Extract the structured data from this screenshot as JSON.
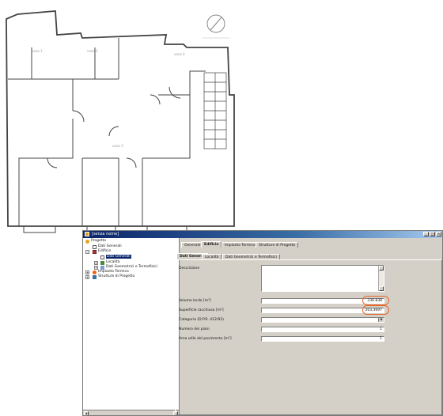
{
  "floor_plan": {
    "room_labels": [
      "vano 1",
      "vano 2",
      "vano 3",
      "vano 4"
    ],
    "north_symbol": "north-arrow-icon",
    "line_color": "#444444"
  },
  "window": {
    "title": "[senza nome]",
    "title_icon": "project-icon",
    "controls": [
      "_",
      "□",
      "×"
    ]
  },
  "tree": {
    "items": [
      {
        "label": "Progetto",
        "icon": "project-icon"
      },
      {
        "label": "Dati Generali",
        "icon": "document-icon"
      },
      {
        "label": "Edificio",
        "icon": "building-icon"
      },
      {
        "label": "Dati Generali",
        "icon": "document-icon",
        "selected": true
      },
      {
        "label": "Località",
        "icon": "location-icon"
      },
      {
        "label": "Dati Geometrici e Termofisici",
        "icon": "geometry-icon"
      },
      {
        "label": "Impianto Termico",
        "icon": "heating-icon"
      },
      {
        "label": "Strutture di Progetto",
        "icon": "structure-icon"
      }
    ],
    "scroll_left": "◂",
    "scroll_right": "▸"
  },
  "tabs": {
    "main": [
      "Generale",
      "Edificio",
      "Impianto Termico",
      "Strutture di Progetto"
    ],
    "main_active": "Edificio",
    "sub": [
      "Dati Generali",
      "Località",
      "Dati Geometrici e Termofisici"
    ],
    "sub_active": "Dati Generali"
  },
  "form": {
    "descrizione_label": "Descrizione",
    "descrizione_value": "",
    "fields": [
      {
        "label": "Volume lordo [m³]",
        "value": "236.838",
        "highlight": true
      },
      {
        "label": "Superficie racchiusa [m²]",
        "value": "203,3697",
        "highlight": true
      },
      {
        "label": "Categoria (D.P.R. 412/93)",
        "value": "",
        "type": "select"
      },
      {
        "label": "Numero dei piani",
        "value": "1"
      },
      {
        "label": "Area utile del pavimento [m²]",
        "value": "1"
      }
    ],
    "highlight_color": "#e8652a"
  }
}
